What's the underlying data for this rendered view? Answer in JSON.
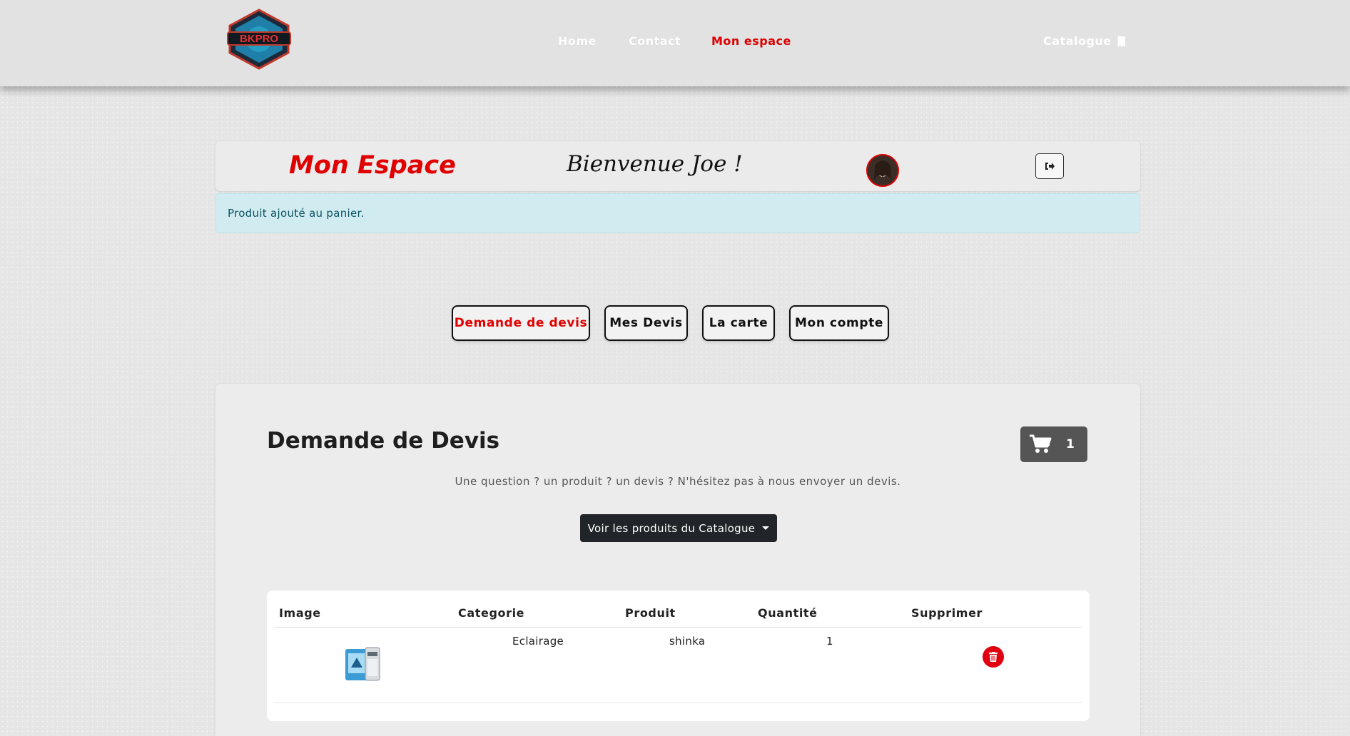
{
  "nav": {
    "logo_text": "BKPRO",
    "links": [
      "Home",
      "Contact",
      "Mon espace"
    ],
    "catalogue": "Catalogue"
  },
  "header": {
    "title": "Mon Espace",
    "welcome": "Bienvenue Joe !"
  },
  "alert": {
    "message": "Produit ajouté au panier."
  },
  "tabs": [
    {
      "label": "Demande de devis"
    },
    {
      "label": "Mes Devis"
    },
    {
      "label": "La carte"
    },
    {
      "label": "Mon compte"
    }
  ],
  "main": {
    "title": "Demande de Devis",
    "cart_count": "1",
    "subtitle": "Une question ? un produit ? un devis ? N'hésitez pas à nous envoyer un devis.",
    "dropdown_label": "Voir les produits du Catalogue"
  },
  "table": {
    "headers": [
      "Image",
      "Categorie",
      "Produit",
      "Quantité",
      "Supprimer"
    ],
    "rows": [
      {
        "categorie": "Eclairage",
        "produit": "shinka",
        "quantite": "1"
      }
    ]
  },
  "colors": {
    "accent": "#e00000",
    "alert_bg": "#d1ecf1",
    "dark_button": "#212529"
  }
}
